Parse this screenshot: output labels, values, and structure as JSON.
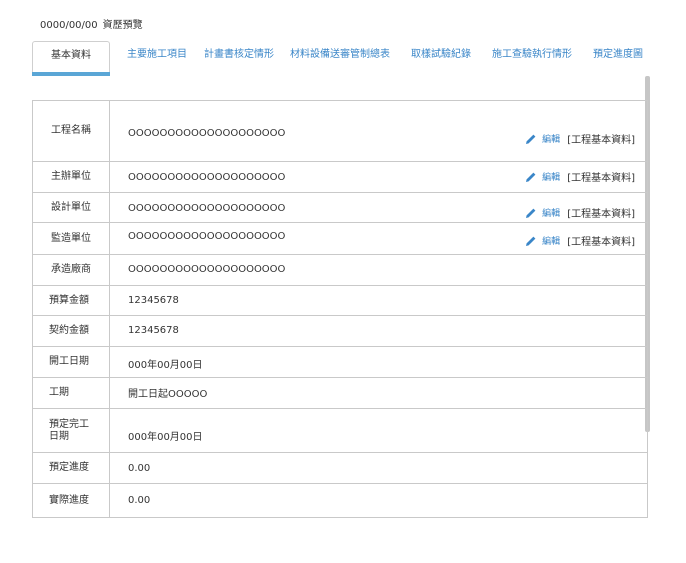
{
  "header": {
    "date": "0000/00/00",
    "title": "資歷預覽"
  },
  "tabs": [
    {
      "label": "基本資料",
      "active": true
    },
    {
      "label": "主要施工項目",
      "active": false
    },
    {
      "label": "計畫書核定情形",
      "active": false
    },
    {
      "label": "材料設備送審管制總表",
      "active": false
    },
    {
      "label": "取樣試驗紀錄",
      "active": false
    },
    {
      "label": "施工查驗執行情形",
      "active": false
    },
    {
      "label": "預定進度圖",
      "active": false
    }
  ],
  "colors": {
    "accent": "#3a86c8",
    "tab_underline": "#5aa6d6",
    "border": "#c9c9c9"
  },
  "rows": [
    {
      "label": "工程名稱",
      "value": "OOOOOOOOOOOOOOOOOOOO",
      "edit_label": "編輯",
      "edit_link": "[工程基本資料]"
    },
    {
      "label": "主辦單位",
      "value": "OOOOOOOOOOOOOOOOOOOO",
      "edit_label": "編輯",
      "edit_link": "[工程基本資料]"
    },
    {
      "label": "設計單位",
      "value": "OOOOOOOOOOOOOOOOOOOO",
      "edit_label": "編輯",
      "edit_link": "[工程基本資料]"
    },
    {
      "label": "監造單位",
      "value": "OOOOOOOOOOOOOOOOOOOO",
      "edit_label": "編輯",
      "edit_link": "[工程基本資料]"
    },
    {
      "label": "承造廠商",
      "value": "OOOOOOOOOOOOOOOOOOOO"
    },
    {
      "label": "預算金額",
      "value": "12345678"
    },
    {
      "label": "契約金額",
      "value": "12345678"
    },
    {
      "label": "開工日期",
      "value": "000年00月00日"
    },
    {
      "label": "工期",
      "value": "開工日起OOOOO"
    },
    {
      "label": "預定完工\n日期",
      "value": "000年00月00日"
    },
    {
      "label": "預定進度",
      "value": "0.00"
    },
    {
      "label": "實際進度",
      "value": "0.00"
    }
  ],
  "icons": {
    "edit": "pencil-icon"
  }
}
